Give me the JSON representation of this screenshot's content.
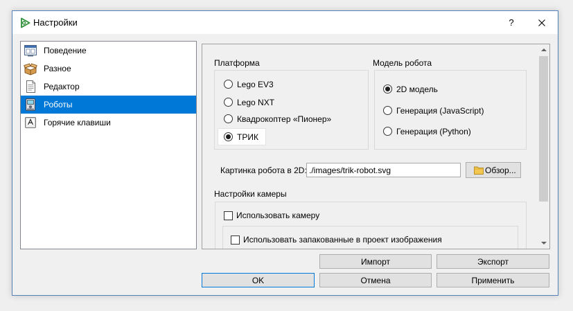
{
  "window": {
    "title": "Настройки",
    "help_label": "?",
    "app_icon": "app-logo-icon",
    "close_icon": "close-icon"
  },
  "sidebar": {
    "items": [
      {
        "label": "Поведение",
        "icon": "behaviour-icon",
        "selected": false
      },
      {
        "label": "Разное",
        "icon": "misc-box-icon",
        "selected": false
      },
      {
        "label": "Редактор",
        "icon": "editor-document-icon",
        "selected": false
      },
      {
        "label": "Роботы",
        "icon": "robot-icon",
        "selected": true
      },
      {
        "label": "Горячие клавиши",
        "icon": "hotkeys-key-icon",
        "selected": false
      }
    ]
  },
  "platform": {
    "title": "Платформа",
    "options": [
      {
        "label": "Lego EV3",
        "checked": false
      },
      {
        "label": "Lego NXT",
        "checked": false
      },
      {
        "label": "Квадрокоптер «Пионер»",
        "checked": false
      },
      {
        "label": "ТРИК",
        "checked": true,
        "focused": true
      }
    ]
  },
  "robot_model": {
    "title": "Модель робота",
    "options": [
      {
        "label": "2D модель",
        "checked": true
      },
      {
        "label": "Генерация (JavaScript)",
        "checked": false
      },
      {
        "label": "Генерация (Python)",
        "checked": false
      }
    ]
  },
  "robot_image": {
    "label": "Картинка робота в 2D:",
    "value": "./images/trik-robot.svg",
    "browse_label": "Обзор...",
    "browse_icon": "folder-icon"
  },
  "camera": {
    "title": "Настройки камеры",
    "use_camera": {
      "label": "Использовать камеру",
      "checked": false
    },
    "use_packed_images": {
      "label": "Использовать запакованные в проект изображения",
      "checked": false
    }
  },
  "buttons": {
    "import": "Импорт",
    "export": "Экспорт",
    "ok": "OK",
    "cancel": "Отмена",
    "apply": "Применить",
    "ok_default": true
  },
  "colors": {
    "selection": "#0078d7",
    "window_border": "#5680b8",
    "default_button_border": "#0078d7"
  }
}
